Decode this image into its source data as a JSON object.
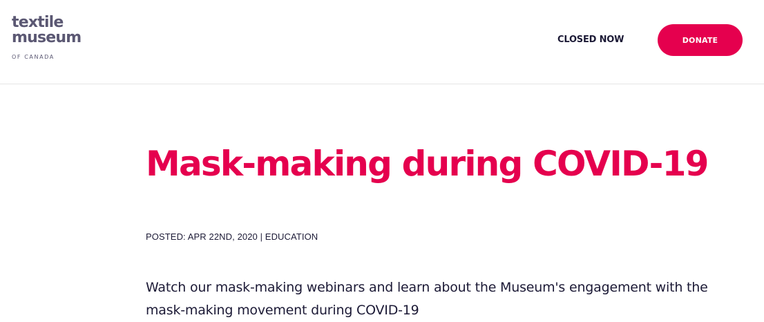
{
  "header": {
    "logo": {
      "line1": "textile",
      "line2": "museum",
      "line3": "OF CANADA"
    },
    "status_label": "CLOSED NOW",
    "donate_label": "DONATE"
  },
  "article": {
    "title": "Mask-making during COVID-19",
    "meta": {
      "posted_prefix": "POSTED: ",
      "date": "APR 22ND, 2020",
      "separator": " | ",
      "category": "EDUCATION"
    },
    "intro": "Watch our mask-making webinars and learn about the Museum's engagement with the mask-making movement during COVID-19"
  },
  "colors": {
    "accent": "#e5004e",
    "logo": "#5b5873",
    "text": "#1c1a36"
  }
}
